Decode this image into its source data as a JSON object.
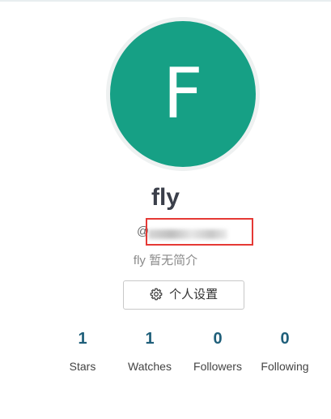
{
  "profile": {
    "avatar_letter": "F",
    "avatar_color": "#16a085",
    "username": "fly",
    "handle_prefix": "@",
    "bio": "fly 暂无简介"
  },
  "actions": {
    "settings_label": "个人设置",
    "settings_icon": "gear-icon"
  },
  "stats": [
    {
      "value": "1",
      "label": "Stars"
    },
    {
      "value": "1",
      "label": "Watches"
    },
    {
      "value": "0",
      "label": "Followers"
    },
    {
      "value": "0",
      "label": "Following"
    }
  ],
  "colors": {
    "accent": "#1f5f7a",
    "highlight": "#e53935"
  }
}
